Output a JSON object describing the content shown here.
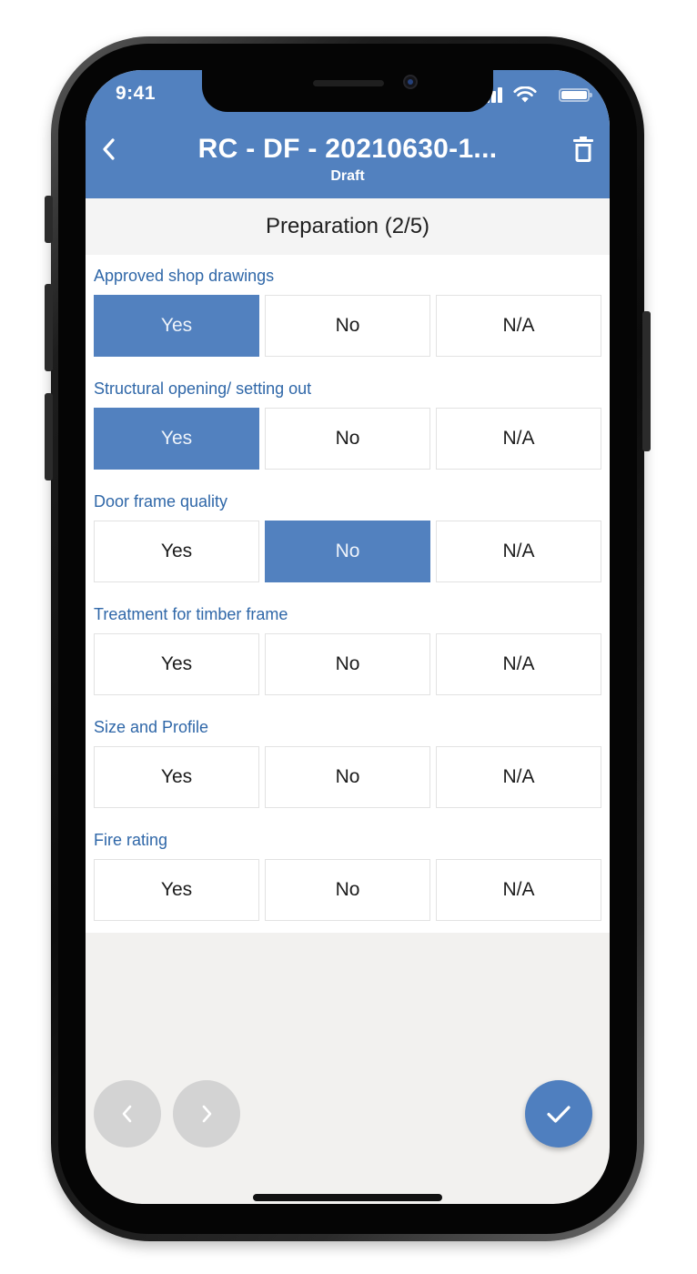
{
  "status_bar": {
    "time": "9:41"
  },
  "header": {
    "title": "RC - DF - 20210630-1...",
    "subtitle": "Draft"
  },
  "section": {
    "title": "Preparation (2/5)"
  },
  "options": {
    "yes": "Yes",
    "no": "No",
    "na": "N/A"
  },
  "questions": [
    {
      "label": "Approved shop drawings",
      "selected": "Yes"
    },
    {
      "label": "Structural opening/ setting out",
      "selected": "Yes"
    },
    {
      "label": "Door frame quality",
      "selected": "No"
    },
    {
      "label": "Treatment for timber frame",
      "selected": null
    },
    {
      "label": "Size and Profile",
      "selected": null
    },
    {
      "label": "Fire rating",
      "selected": null
    }
  ],
  "colors": {
    "header": "#5281bf",
    "selected_option": "#5281bf",
    "question_label": "#2f67a8",
    "done_button": "#4f7fbf",
    "nav_button_disabled": "#d3d3d3",
    "background": "#f2f1ef"
  },
  "icons": {
    "back": "chevron-left-icon",
    "delete": "trash-icon",
    "previous": "chevron-left-icon",
    "next": "chevron-right-icon",
    "done": "check-icon"
  }
}
